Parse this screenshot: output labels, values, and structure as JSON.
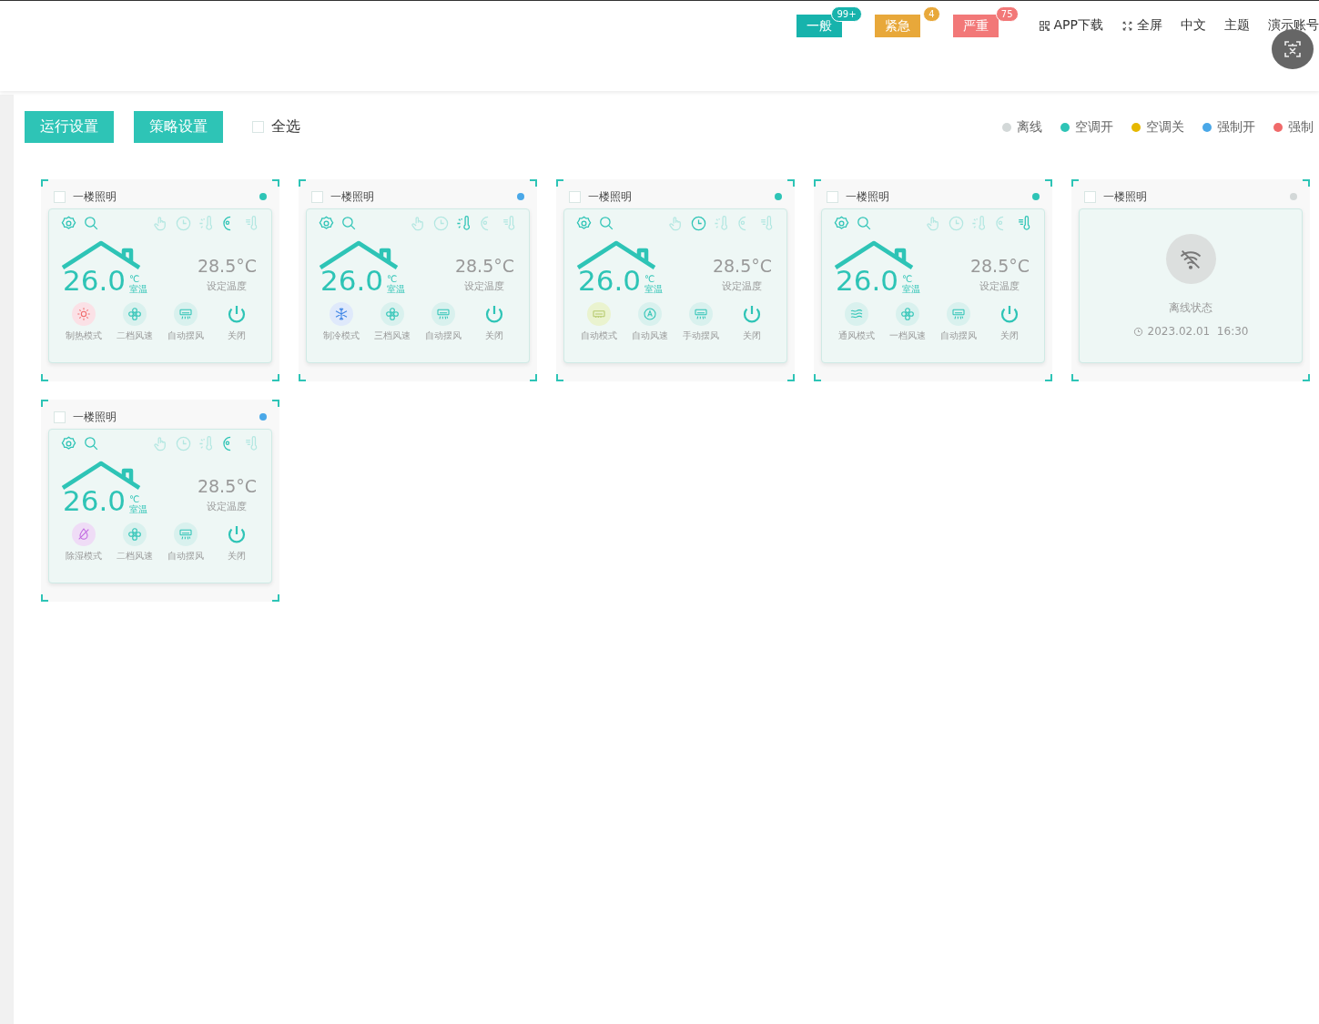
{
  "header": {
    "alerts": [
      {
        "label": "一般",
        "count": "99+",
        "color": "#17b3ac"
      },
      {
        "label": "紧急",
        "count": "4",
        "color": "#e8a83a"
      },
      {
        "label": "严重",
        "count": "75",
        "color": "#f27878"
      }
    ],
    "links": [
      {
        "kind": "app",
        "label": "APP下载"
      },
      {
        "kind": "fullscreen",
        "label": "全屏"
      },
      {
        "kind": "text",
        "label": "中文"
      },
      {
        "kind": "text",
        "label": "主题"
      },
      {
        "kind": "text",
        "label": "演示账号"
      }
    ]
  },
  "toolbar": {
    "buttons": [
      "运行设置",
      "策略设置"
    ],
    "select_all": {
      "label": "全选",
      "checked": false
    },
    "legend": [
      {
        "label": "离线",
        "color": "#d3d8d8"
      },
      {
        "label": "空调开",
        "color": "#2ec4b6"
      },
      {
        "label": "空调关",
        "color": "#e6b800"
      },
      {
        "label": "强制开",
        "color": "#4aa8e8"
      },
      {
        "label": "强制",
        "color": "#f06a6a"
      }
    ]
  },
  "devices": [
    {
      "kind": "online",
      "title": "一楼照明",
      "checked": false,
      "color": "#2ec4b6",
      "functions": [
        {
          "kind": "hand",
          "selected": false
        },
        {
          "kind": "clock",
          "selected": false
        },
        {
          "kind": "sunthermo",
          "selected": false
        },
        {
          "kind": "moon",
          "selected": true
        },
        {
          "kind": "thermo",
          "selected": false
        }
      ],
      "room_temp": "26.0",
      "unit": "℃",
      "room_label": "室温",
      "set_temp": "28.5°C",
      "set_label": "设定温度",
      "controls": [
        {
          "kind": "heat",
          "label": "制热模式"
        },
        {
          "kind": "fan",
          "label": "二档风速"
        },
        {
          "kind": "swing",
          "label": "自动摆风"
        },
        {
          "kind": "power",
          "label": "关闭"
        }
      ]
    },
    {
      "kind": "online",
      "title": "一楼照明",
      "checked": false,
      "color": "#4aa8e8",
      "functions": [
        {
          "kind": "hand",
          "selected": false
        },
        {
          "kind": "clock",
          "selected": false
        },
        {
          "kind": "sunthermo",
          "selected": true
        },
        {
          "kind": "moon",
          "selected": false
        },
        {
          "kind": "thermo",
          "selected": false
        }
      ],
      "room_temp": "26.0",
      "unit": "℃",
      "room_label": "室温",
      "set_temp": "28.5°C",
      "set_label": "设定温度",
      "controls": [
        {
          "kind": "cool",
          "label": "制冷模式"
        },
        {
          "kind": "fan",
          "label": "三档风速"
        },
        {
          "kind": "swing",
          "label": "自动摆风"
        },
        {
          "kind": "power",
          "label": "关闭"
        }
      ]
    },
    {
      "kind": "online",
      "title": "一楼照明",
      "checked": false,
      "color": "#2ec4b6",
      "functions": [
        {
          "kind": "hand",
          "selected": false
        },
        {
          "kind": "clock",
          "selected": true
        },
        {
          "kind": "sunthermo",
          "selected": false
        },
        {
          "kind": "moon",
          "selected": false
        },
        {
          "kind": "thermo",
          "selected": false
        }
      ],
      "room_temp": "26.0",
      "unit": "℃",
      "room_label": "室温",
      "set_temp": "28.5°C",
      "set_label": "设定温度",
      "controls": [
        {
          "kind": "auto",
          "label": "自动模式"
        },
        {
          "kind": "autofan",
          "label": "自动风速"
        },
        {
          "kind": "swing",
          "label": "手动摆风"
        },
        {
          "kind": "power",
          "label": "关闭"
        }
      ]
    },
    {
      "kind": "online",
      "title": "一楼照明",
      "checked": false,
      "color": "#2ec4b6",
      "functions": [
        {
          "kind": "hand",
          "selected": false
        },
        {
          "kind": "clock",
          "selected": false
        },
        {
          "kind": "sunthermo",
          "selected": false
        },
        {
          "kind": "moon",
          "selected": false
        },
        {
          "kind": "thermo",
          "selected": true
        }
      ],
      "room_temp": "26.0",
      "unit": "℃",
      "room_label": "室温",
      "set_temp": "28.5°C",
      "set_label": "设定温度",
      "controls": [
        {
          "kind": "vent",
          "label": "通风模式"
        },
        {
          "kind": "fan",
          "label": "一档风速"
        },
        {
          "kind": "swing",
          "label": "自动摆风"
        },
        {
          "kind": "power",
          "label": "关闭"
        }
      ]
    },
    {
      "kind": "offline",
      "title": "一楼照明",
      "checked": false,
      "color": "#d3d8d8",
      "status": "离线状态",
      "time": "2023.02.01  16:30"
    },
    {
      "kind": "online",
      "title": "一楼照明",
      "checked": false,
      "color": "#4aa8e8",
      "functions": [
        {
          "kind": "hand",
          "selected": false
        },
        {
          "kind": "clock",
          "selected": false
        },
        {
          "kind": "sunthermo",
          "selected": false
        },
        {
          "kind": "moon",
          "selected": true
        },
        {
          "kind": "thermo",
          "selected": false
        }
      ],
      "room_temp": "26.0",
      "unit": "℃",
      "room_label": "室温",
      "set_temp": "28.5°C",
      "set_label": "设定温度",
      "controls": [
        {
          "kind": "dry",
          "label": "除湿模式"
        },
        {
          "kind": "fan",
          "label": "二档风速"
        },
        {
          "kind": "swing",
          "label": "自动摆风"
        },
        {
          "kind": "power",
          "label": "关闭"
        }
      ]
    }
  ]
}
